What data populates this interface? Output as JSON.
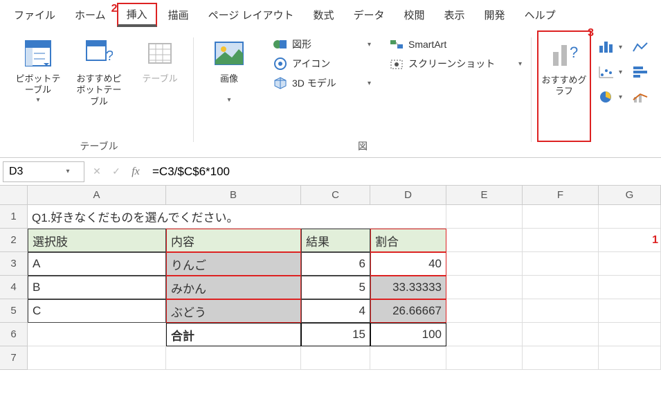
{
  "menu": {
    "file": "ファイル",
    "home": "ホーム",
    "insert": "挿入",
    "draw": "描画",
    "layout": "ページ レイアウト",
    "formula": "数式",
    "data": "データ",
    "review": "校閲",
    "view": "表示",
    "dev": "開発",
    "help": "ヘルプ"
  },
  "annotations": {
    "a1": "1",
    "a2": "2",
    "a3": "3"
  },
  "ribbon": {
    "tables": {
      "pivot": "ピボットテーブル",
      "rec_pivot": "おすすめピボットテーブル",
      "table": "テーブル",
      "group": "テーブル"
    },
    "illus": {
      "image": "画像",
      "shapes": "図形",
      "icons": "アイコン",
      "models": "3D モデル",
      "smartart": "SmartArt",
      "screenshot": "スクリーンショット",
      "group": "図"
    },
    "charts": {
      "rec": "おすすめグラフ"
    }
  },
  "namebox": "D3",
  "formula": "=C3/$C$6*100",
  "cols": [
    "A",
    "B",
    "C",
    "D",
    "E",
    "F",
    "G"
  ],
  "rows": [
    "1",
    "2",
    "3",
    "4",
    "5",
    "6",
    "7"
  ],
  "cells": {
    "q": "Q1.好きなくだものを選んでください。",
    "h_choice": "選択肢",
    "h_content": "内容",
    "h_result": "結果",
    "h_ratio": "割合",
    "a3": "A",
    "a4": "B",
    "a5": "C",
    "b3": "りんご",
    "b4": "みかん",
    "b5": "ぶどう",
    "b6": "合計",
    "c3": "6",
    "c4": "5",
    "c5": "4",
    "c6": "15",
    "d3": "40",
    "d4": "33.33333",
    "d5": "26.66667",
    "d6": "100"
  },
  "chart_data": {
    "type": "table",
    "title": "Q1.好きなくだものを選んでください。",
    "categories": [
      "A",
      "B",
      "C"
    ],
    "series": [
      {
        "name": "内容",
        "values": [
          "りんご",
          "みかん",
          "ぶどう"
        ]
      },
      {
        "name": "結果",
        "values": [
          6,
          5,
          4
        ]
      },
      {
        "name": "割合",
        "values": [
          40,
          33.33333,
          26.66667
        ]
      }
    ],
    "totals": {
      "結果": 15,
      "割合": 100
    }
  }
}
